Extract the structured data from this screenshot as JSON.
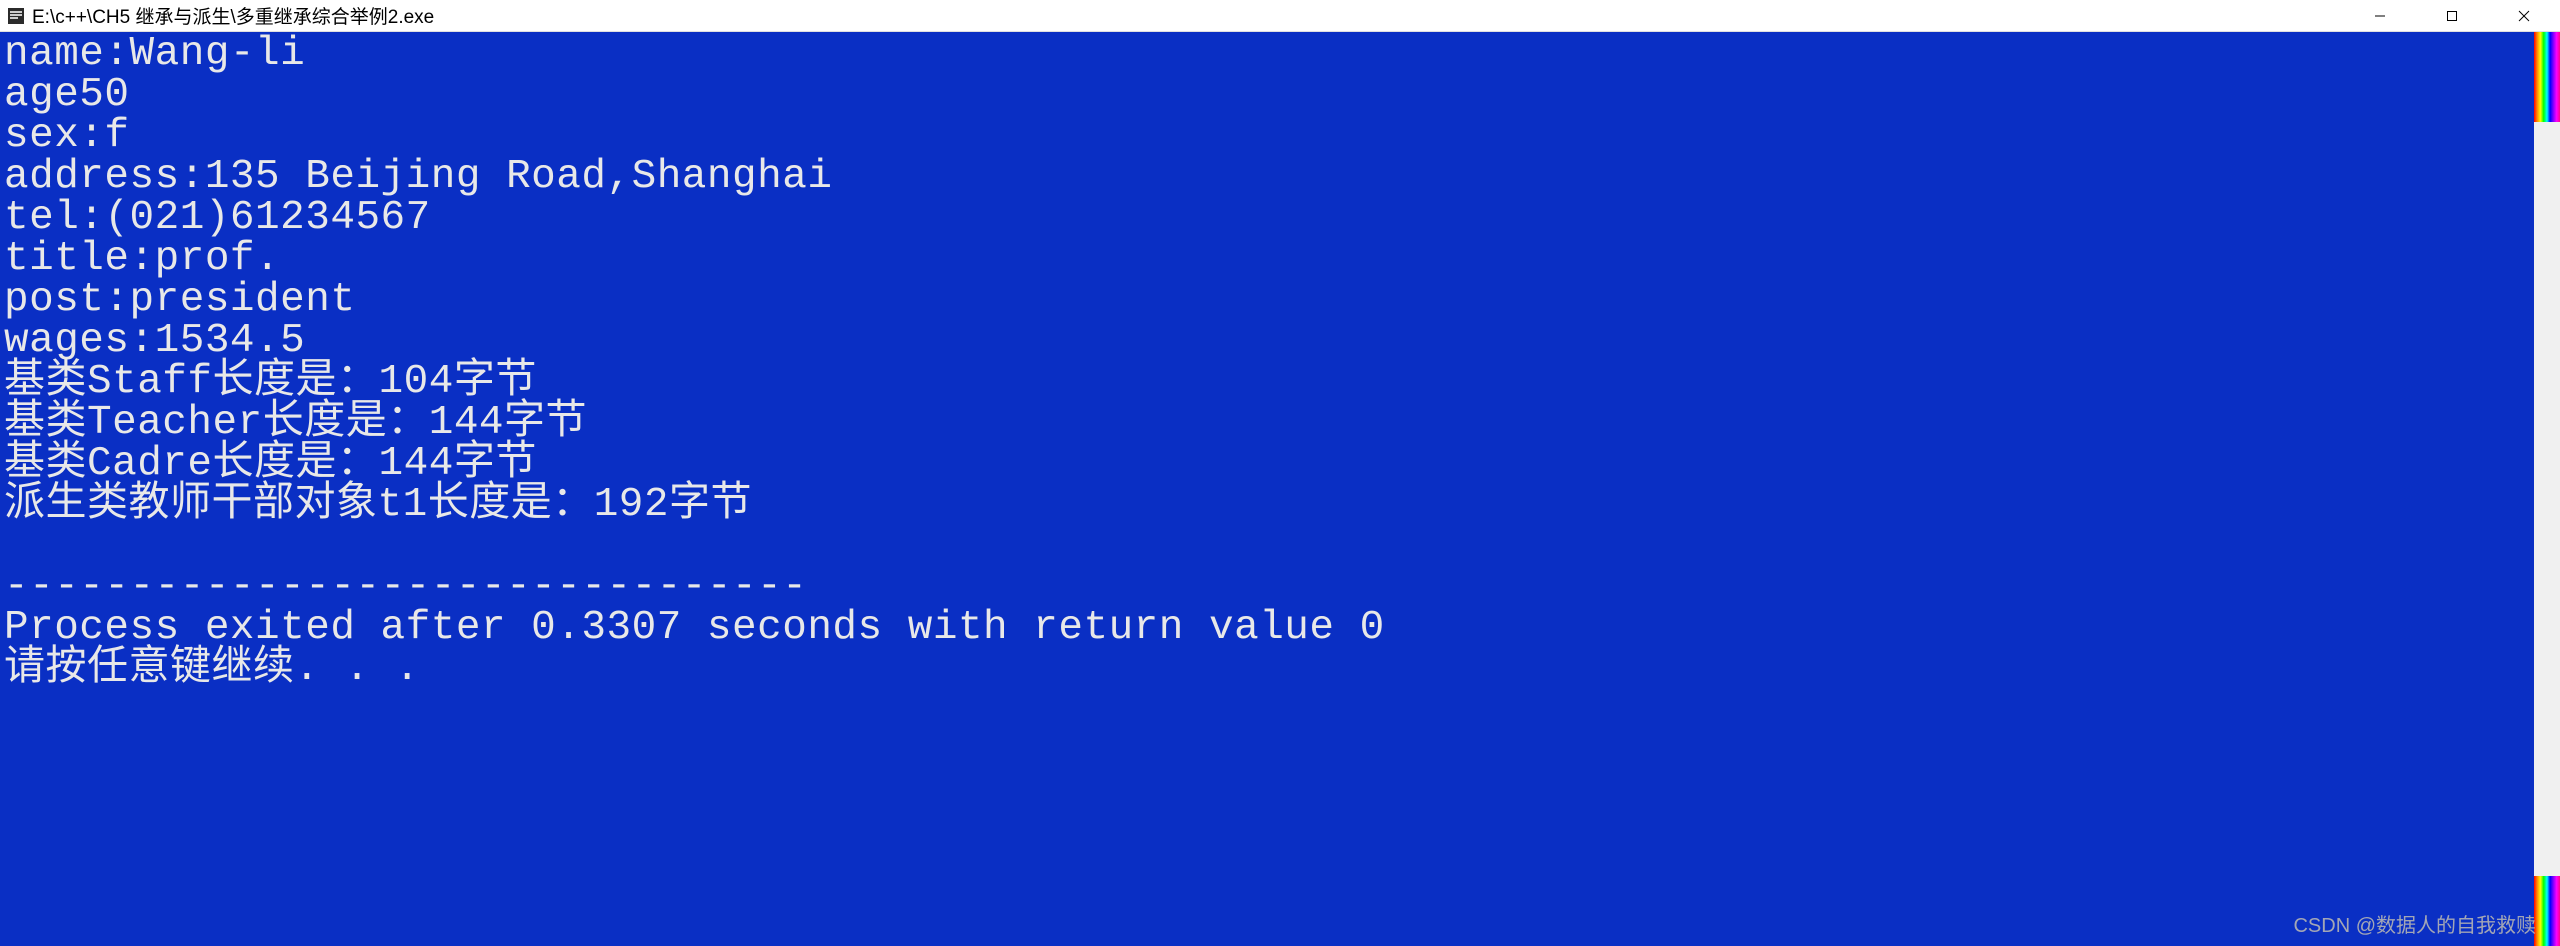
{
  "window": {
    "title": "E:\\c++\\CH5 继承与派生\\多重继承综合举例2.exe"
  },
  "console": {
    "lines": [
      "name:Wang-li",
      "age50",
      "sex:f",
      "address:135 Beijing Road,Shanghai",
      "tel:(021)61234567",
      "title:prof.",
      "post:president",
      "wages:1534.5",
      "基类Staff长度是：104字节",
      "基类Teacher长度是：144字节",
      "基类Cadre长度是：144字节",
      "派生类教师干部对象t1长度是：192字节",
      "",
      "--------------------------------",
      "Process exited after 0.3307 seconds with return value 0",
      "请按任意键继续. . ."
    ]
  },
  "watermark": "CSDN @数据人的自我救赎"
}
